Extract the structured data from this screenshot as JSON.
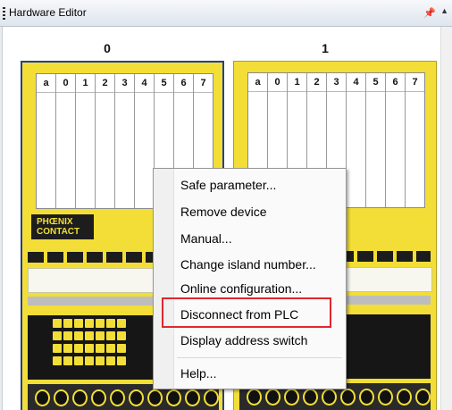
{
  "window": {
    "title": "Hardware Editor",
    "pin_icon": "pin-icon",
    "scroll_icon": "arrow-up-icon"
  },
  "columns": [
    {
      "label": "0"
    },
    {
      "label": "1"
    }
  ],
  "terminal_headers": [
    "a",
    "0",
    "1",
    "2",
    "3",
    "4",
    "5",
    "6",
    "7"
  ],
  "module": {
    "brand_line1": "PHŒNIX",
    "brand_line2": "CONTACT"
  },
  "context_menu": {
    "items": [
      "Safe parameter...",
      "Remove device",
      "Manual...",
      "Change island number...",
      "Online configuration...",
      "Disconnect from PLC",
      "Display address switch",
      "Help..."
    ]
  },
  "colors": {
    "module_yellow": "#f2de36",
    "selection_blue": "#253f8f",
    "highlight_red": "#e0262d"
  }
}
